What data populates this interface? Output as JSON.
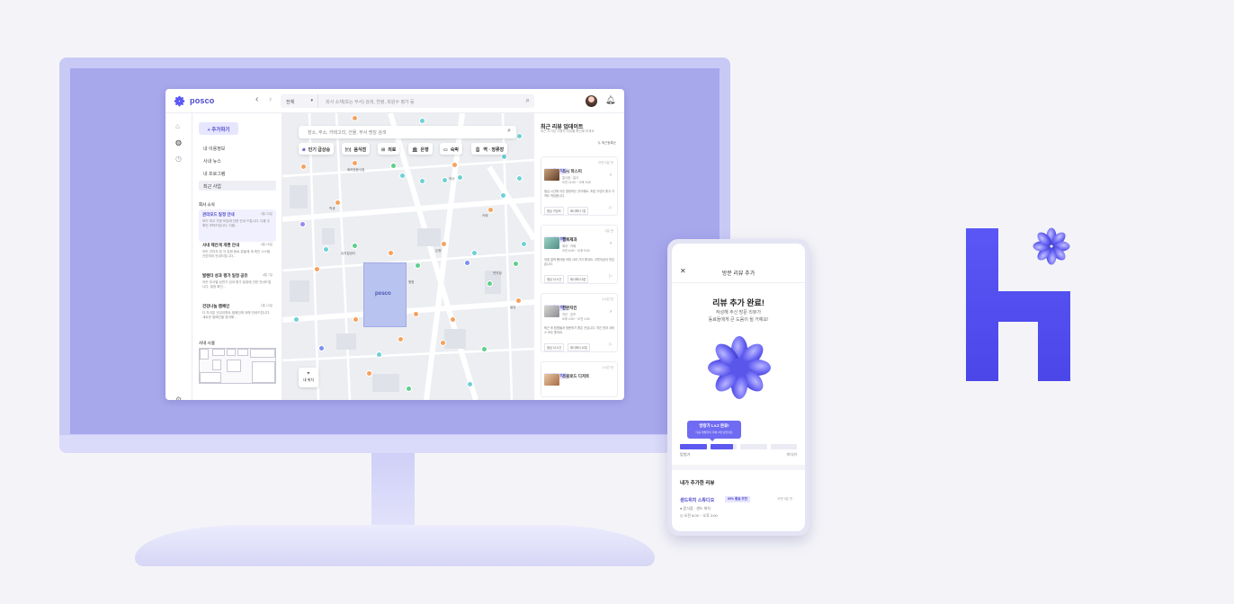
{
  "colors": {
    "accent": "#4a46c8",
    "brand_blue": "#5b57f6",
    "monitor_bezel": "#c9c9f6",
    "background": "#f4f4f8"
  },
  "app": {
    "logo_text": "posco",
    "search": {
      "category": "전체",
      "placeholder": "회사 소재(또는 부서) 검색, 연령, 회원수 평가 등"
    },
    "sidebar": {
      "add_button": "+ 추가하기",
      "items": [
        {
          "label": "내 이용정보"
        },
        {
          "label": "사내 뉴스"
        },
        {
          "label": "내 프로그램"
        },
        {
          "label": "최근 사업",
          "active": true
        }
      ],
      "news_section_title": "회사 소식",
      "news": [
        {
          "title": "관리모드 일정 안내",
          "date": "4월 20일",
          "body": "모드 하고 가정 모임에 관한 안내 드립니다. 다음 주 확인 부탁드립니다. 다음...",
          "highlight": true
        },
        {
          "title": "사내 제안게 개편 안내",
          "date": "4월 18일",
          "body": "모든 관리자 및 각 임원 동료 분들께 새 제안 시스템 관련하여 안내드립니다..."
        },
        {
          "title": "발렌타 성과 평가 일정 공유",
          "date": "4월 7일",
          "body": "모든 부서별 상반기 성과 평가 일정에 관한 안내드립니다. 일정 확인..."
        },
        {
          "title": "건강나눔 캠페인",
          "date": "1월 10일",
          "body": "다 자녀분 신입이벤트 캠페인에 대해 안내드립니다. 새로운 캠페인을 참여해..."
        }
      ],
      "floor_section_title": "사내 시설"
    },
    "map": {
      "search_placeholder": "장소, 주소, 카테고리, 건물, 부서 명칭 검색",
      "chips": [
        {
          "label": "인기 급상승",
          "icon": "fire-icon"
        },
        {
          "label": "음식점",
          "icon": "food-icon"
        },
        {
          "label": "의료",
          "icon": "medical-icon"
        },
        {
          "label": "은행",
          "icon": "bank-icon"
        },
        {
          "label": "숙박",
          "icon": "bed-icon"
        },
        {
          "label": "역 · 정류장",
          "icon": "train-icon"
        }
      ],
      "building_label": "posco",
      "my_location": "내 위치",
      "place_labels": [
        "화려한음식점",
        "뮤지컬센터",
        "약사",
        "병원",
        "학생",
        "은행",
        "카페",
        "빌딩",
        "편의점"
      ]
    },
    "reviews": {
      "title": "최근 리뷰 업데이트",
      "subtitle": "최근 추가된 사용자 리뷰를 확인해 보세요.",
      "sort": "최근등록순",
      "cards": [
        {
          "badge": "69% 좋음 추천",
          "time": "이번 3분 전",
          "name": "스시 하스미",
          "meta1": "일식점 · 일식",
          "meta2": "오전 11:00 ~ 오후 9:00",
          "text": "점심 시간에 자주 방문하는 곳이에요. 초밥 구성이 좋고 가격도 적당합니다.",
          "tags": [
            "점심 가성비",
            "회사에서 7분"
          ]
        },
        {
          "badge": "68% 좋음 추천",
          "time": "2분 전",
          "name": "행복제과",
          "meta1": "제과 · 카페",
          "meta2": "오전 6:00 ~ 오후 9:00",
          "text": "아침 일찍 빵이랑 커피 사러 가기 좋아요. 크루아상이 맛있습니다.",
          "tags": [
            "점심 12시간",
            "회사에서 5분"
          ]
        },
        {
          "badge": "66% 좋음 추천",
          "time": "1시간 전",
          "name": "한판치킨",
          "meta1": "치킨 · 호프",
          "meta2": "오후 4:00 ~ 오전 1:00",
          "text": "퇴근 후 팀원들과 방문하기 좋은 곳입니다. 치킨 맛과 서비스 모두 좋아요.",
          "tags": [
            "점심 12시간",
            "회사에서 10분"
          ]
        },
        {
          "badge": "77% 좋음 추천",
          "time": "1시간 전",
          "name": "스윗로드 디저트",
          "meta1": "",
          "meta2": "",
          "text": "",
          "tags": []
        }
      ]
    }
  },
  "phone": {
    "header": "방문 리뷰 추가",
    "title": "리뷰 추가 완료!",
    "desc_line1": "작성해 주신 방문 리뷰가",
    "desc_line2": "동료들에게 큰 도움이 될 거예요!",
    "tooltip_line1": "방랑가 Lv.2 완료!",
    "tooltip_line2": "다음 레벨까지 리뷰 3개 남았어요",
    "progress": {
      "segments_total": 4,
      "completed_fraction": 0.45
    },
    "level_start": "탐험가",
    "level_end": "미식가",
    "my_reviews_title": "내가 추가한 리뷰",
    "review": {
      "place": "샌드위치 스튜디오",
      "badge": "69% 좋음 추천",
      "time": "이번 3분 전",
      "meta1": "음식점 · 샌드 위치",
      "meta2": "오전 8:00 ~ 오후 3:00"
    }
  }
}
